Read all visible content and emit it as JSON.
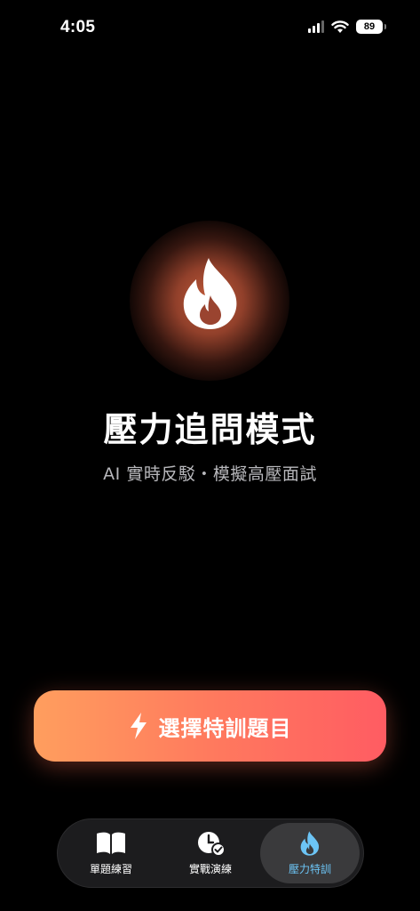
{
  "status_bar": {
    "time": "4:05",
    "battery": "89"
  },
  "hero": {
    "icon": "flame-icon",
    "title": "壓力追問模式",
    "subtitle": "AI 實時反駁・模擬高壓面試"
  },
  "cta": {
    "icon": "lightning-icon",
    "label": "選擇特訓題目"
  },
  "tab_bar": {
    "tabs": [
      {
        "label": "單題練習",
        "icon": "book-icon",
        "active": false
      },
      {
        "label": "實戰演練",
        "icon": "clock-check-icon",
        "active": false
      },
      {
        "label": "壓力特訓",
        "icon": "flame-icon",
        "active": true
      }
    ]
  },
  "colors": {
    "background": "#000000",
    "cta_gradient_start": "#ff9e5e",
    "cta_gradient_end": "#ff5c62",
    "active_tab_label": "#6cc4f5",
    "glow": "#c45c3a"
  }
}
